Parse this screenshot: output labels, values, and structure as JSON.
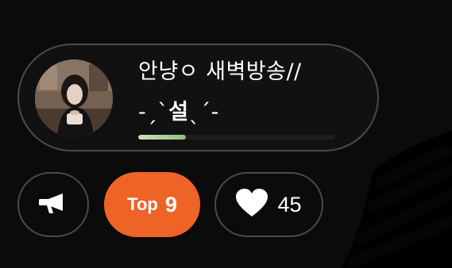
{
  "stream": {
    "title_line1": "안냥ㅇ 새벽방송//",
    "title_line2_prefix": "-ˏˋ",
    "title_line2_strong": "설",
    "title_line2_suffix": "ˎˊ-",
    "progress_fraction": 0.24,
    "progress_color": "#a8d49a"
  },
  "actions": {
    "announce_icon": "megaphone-icon",
    "rank_label": "Top",
    "rank_number": "9",
    "rank_color": "#ee6427",
    "like_icon": "heart-icon",
    "like_count": "45"
  }
}
